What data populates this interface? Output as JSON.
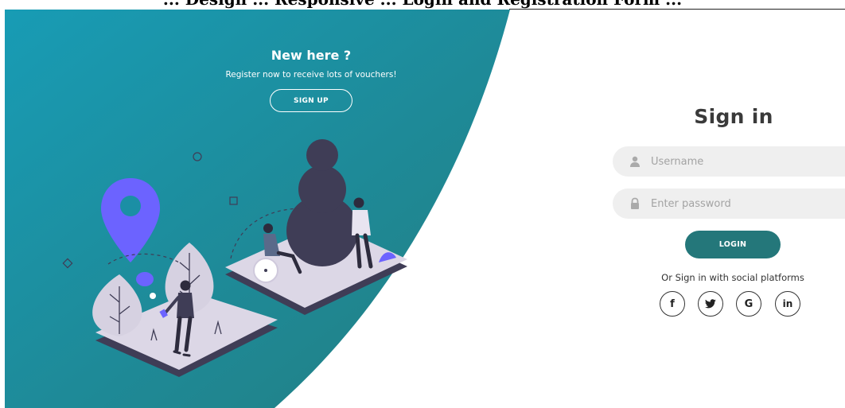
{
  "header_fragment": "... Design ... Responsive ... Login and Registration Form ...",
  "panel": {
    "title": "New here ?",
    "text": "Register now to receive lots of vouchers!",
    "signup_label": "SIGN UP",
    "gradient_start": "#1898b2",
    "gradient_end": "#238080"
  },
  "form": {
    "title": "Sign in",
    "username_placeholder": "Username",
    "password_placeholder": "Enter password",
    "login_label": "LOGIN",
    "social_text": "Or Sign in with social platforms",
    "accent": "#24777a",
    "field_bg": "#efefef"
  },
  "social": {
    "facebook": "f",
    "twitter": "twitter-bird-icon",
    "google": "G",
    "linkedin": "in"
  },
  "illustration": {
    "accent_purple": "#6c63ff",
    "ground": "#dcd7e6",
    "dark": "#3f3d56"
  }
}
